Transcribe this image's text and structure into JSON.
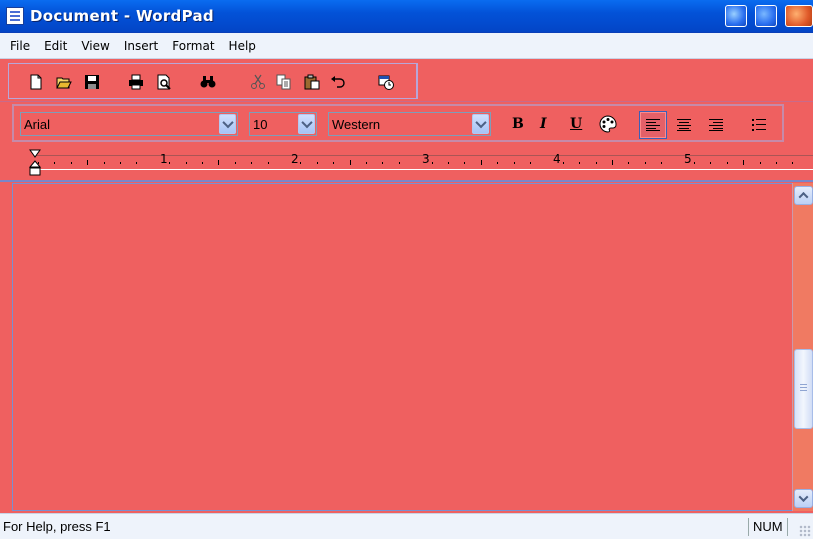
{
  "window": {
    "title": "Document - WordPad"
  },
  "menu": [
    "File",
    "Edit",
    "View",
    "Insert",
    "Format",
    "Help"
  ],
  "toolbar": {
    "buttons": [
      "new-icon",
      "open-icon",
      "save-icon",
      "print-icon",
      "print-preview-icon",
      "find-icon",
      "cut-icon",
      "copy-icon",
      "paste-icon",
      "undo-icon",
      "insert-datetime-icon"
    ]
  },
  "format_bar": {
    "font": "Arial",
    "size": "10",
    "script": "Western",
    "bold": "B",
    "italic": "I",
    "underline": "U",
    "alignment_selected": "left"
  },
  "ruler": {
    "numbers": [
      "1",
      "2",
      "3",
      "4",
      "5"
    ]
  },
  "status": {
    "help_text": "For Help, press F1",
    "num": "NUM"
  },
  "colors": {
    "title_bar": "#0352d8",
    "workspace": "#ef6060",
    "menu_bg": "#eef3fb"
  }
}
